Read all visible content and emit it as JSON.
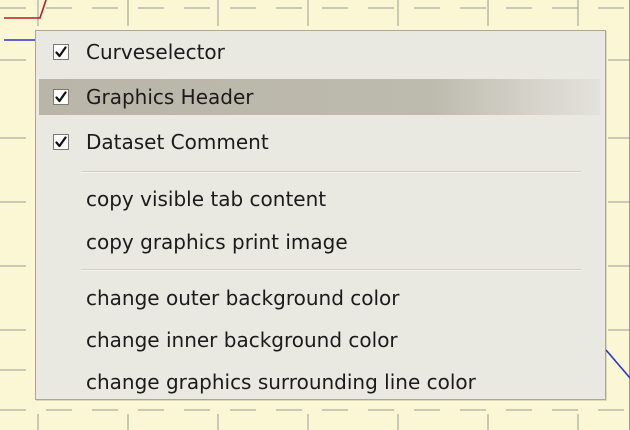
{
  "colors": {
    "plot_background": "#fbf6d4",
    "grid_line": "#9a9a9a",
    "curve_blue": "#2a36c9",
    "curve_red": "#b02020",
    "menu_background": "#e9e8e1",
    "menu_highlight": "#bdbaae"
  },
  "context_menu": {
    "toggles": [
      {
        "label": "Curveselector",
        "checked": true,
        "icon": "checkmark-icon"
      },
      {
        "label": "Graphics Header",
        "checked": true,
        "icon": "checkmark-icon",
        "highlighted": true
      },
      {
        "label": "Dataset Comment",
        "checked": true,
        "icon": "checkmark-icon"
      }
    ],
    "copy_actions": [
      {
        "label": "copy visible tab content"
      },
      {
        "label": "copy graphics print image"
      }
    ],
    "color_actions": [
      {
        "label": "change outer background color"
      },
      {
        "label": "change inner background color"
      },
      {
        "label": "change graphics surrounding line color"
      }
    ]
  }
}
